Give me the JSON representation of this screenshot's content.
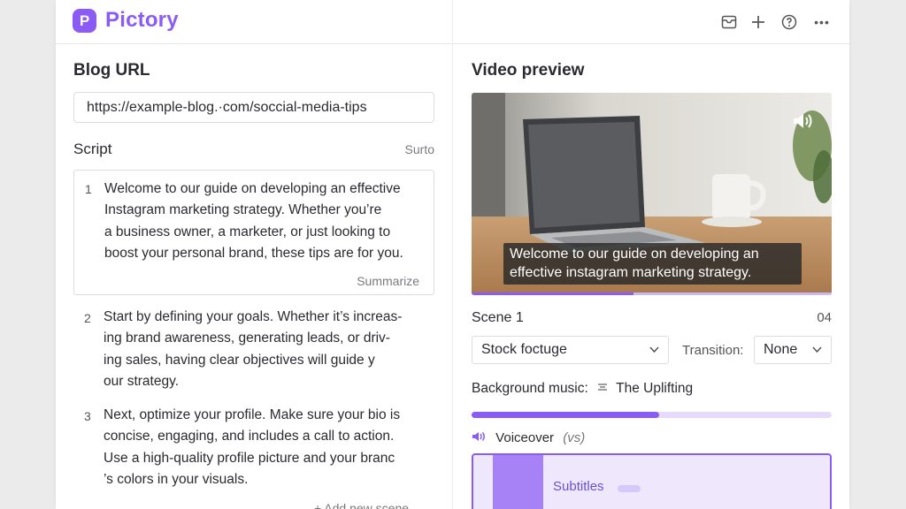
{
  "app": {
    "name": "Pictory",
    "logo_letter": "P",
    "accent": "#8a5cf5"
  },
  "toolbar": {
    "icons": [
      "inbox-icon",
      "plus-icon",
      "help-icon",
      "more-icon"
    ],
    "more_glyph": "•••"
  },
  "left": {
    "blog_url_title": "Blog URL",
    "blog_url_value": "https://example-blog.·com/soccial-media-tips",
    "script_label": "Script",
    "script_aside": "Surto",
    "scenes": [
      {
        "number": "1",
        "text": "Welcome to our guide on developing an effective\nInstagram marketing strategy. Whether you’re\na business owner, a marketer, or just looking to\nboost your personal brand, these tips are for you.",
        "action": "Summarize"
      },
      {
        "number": "2",
        "text": "Start by defining your goals. Whether it’s increas-\ning brand awareness, generating leads, or driv-\ning sales, having clear objectives will guide y\nour strategy."
      },
      {
        "number": "3",
        "text": "Next, optimize your profile. Make sure your bio is\nconcise, engaging, and includes a call to action.\nUse a high-quality profile picture and your branc\n’s colors in your visuals."
      }
    ],
    "add_scene": "+ Add new scene"
  },
  "right": {
    "video_preview_title": "Video preview",
    "caption_line1": "Welcome to our guide on developing an",
    "caption_line2": "effective instagram marketing strategy.",
    "video_progress": 0.45,
    "scene_label": "Scene 1",
    "scene_count": "04",
    "visual_select": "Stock foctuge",
    "transition_label": "Transition:",
    "transition_select": "None",
    "bg_music_label": "Background music:",
    "bg_music_value": "The Uplifting",
    "music_progress": 0.52,
    "voiceover_label": "Voiceover",
    "voiceover_note": "(vs)",
    "timeline_label": "Subtitles"
  }
}
